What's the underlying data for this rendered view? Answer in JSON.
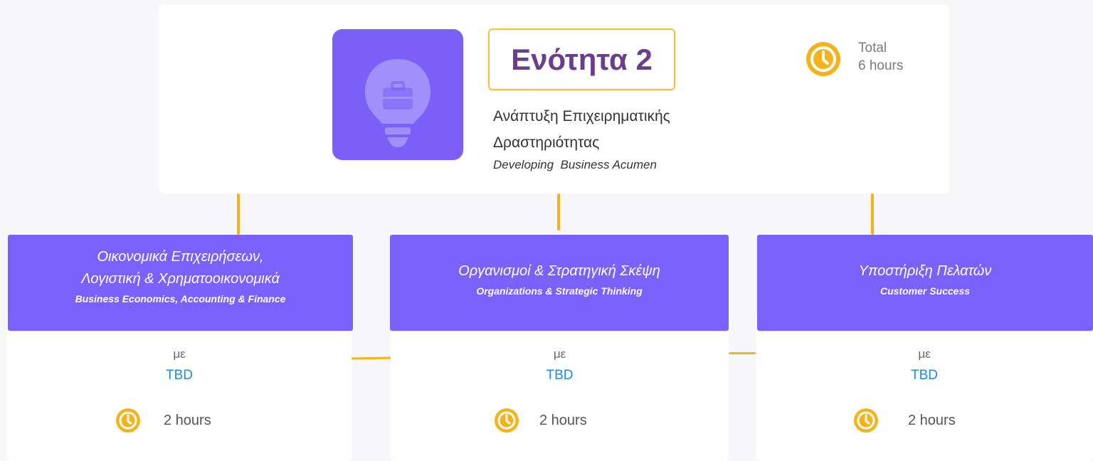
{
  "module": {
    "badge": "Ενότητα 2",
    "title_greek_line1": "Ανάπτυξη Επιχειρηματικής",
    "title_greek_line2": "Δραστηριότητας",
    "title_en": "Developing  Business Acumen",
    "total_label": "Total",
    "total_hours": "6 hours",
    "icon": "lightbulb-briefcase-icon"
  },
  "colors": {
    "primary": "#7b61fc",
    "accent": "#f5b21b",
    "badge_text": "#6a3e8d",
    "instructor": "#1e88e5"
  },
  "courses": [
    {
      "title_greek_line1": "Οικονομικά Επιχειρήσεων,",
      "title_greek_line2": "Λογιστική & Χρηματοοικονομικά",
      "title_en": "Business Economics, Accounting & Finance",
      "by": "με",
      "instructor": "TBD",
      "hours": "2 hours"
    },
    {
      "title_greek_line1": "Οργανισμοί & Στρατηγική Σκέψη",
      "title_en": "Organizations & Strategic Thinking",
      "by": "με",
      "instructor": "TBD",
      "hours": "2 hours"
    },
    {
      "title_greek_line1": "Υποστήριξη Πελατών",
      "title_en": "Customer Success",
      "by": "με",
      "instructor": "TBD",
      "hours": "2 hours"
    }
  ]
}
